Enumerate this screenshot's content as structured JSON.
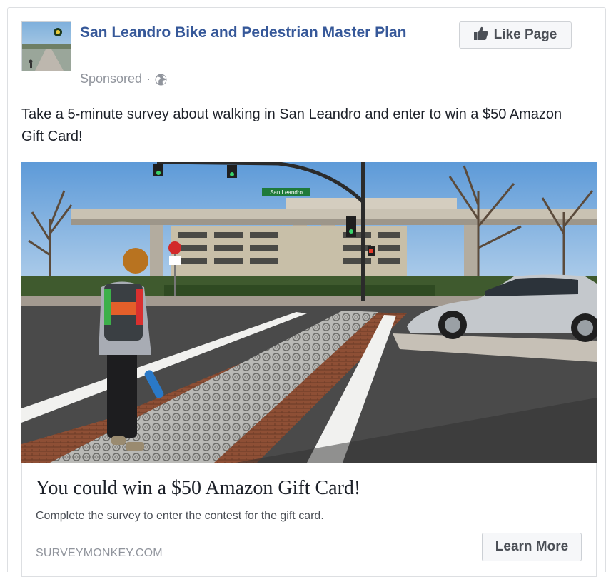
{
  "post": {
    "page_name": "San Leandro Bike and Pedestrian Master Plan",
    "sponsored_label": "Sponsored",
    "separator": "·",
    "privacy_icon": "globe-icon",
    "like_button_label": "Like Page",
    "like_icon": "thumbs-up-icon",
    "body_text": "Take a 5-minute survey about walking in San Leandro and enter to win a $50 Amazon Gift Card!"
  },
  "photo": {
    "street_sign": "San Leandro"
  },
  "link_preview": {
    "headline": "You could win a $50 Amazon Gift Card!",
    "description": "Complete the survey to enter the contest for the gift card.",
    "domain": "SURVEYMONKEY.COM",
    "cta_label": "Learn More"
  },
  "colors": {
    "link_blue": "#365899",
    "text_dark": "#1d2129",
    "text_muted": "#90949c",
    "button_bg": "#f6f7f9",
    "border": "#dddfe2"
  }
}
